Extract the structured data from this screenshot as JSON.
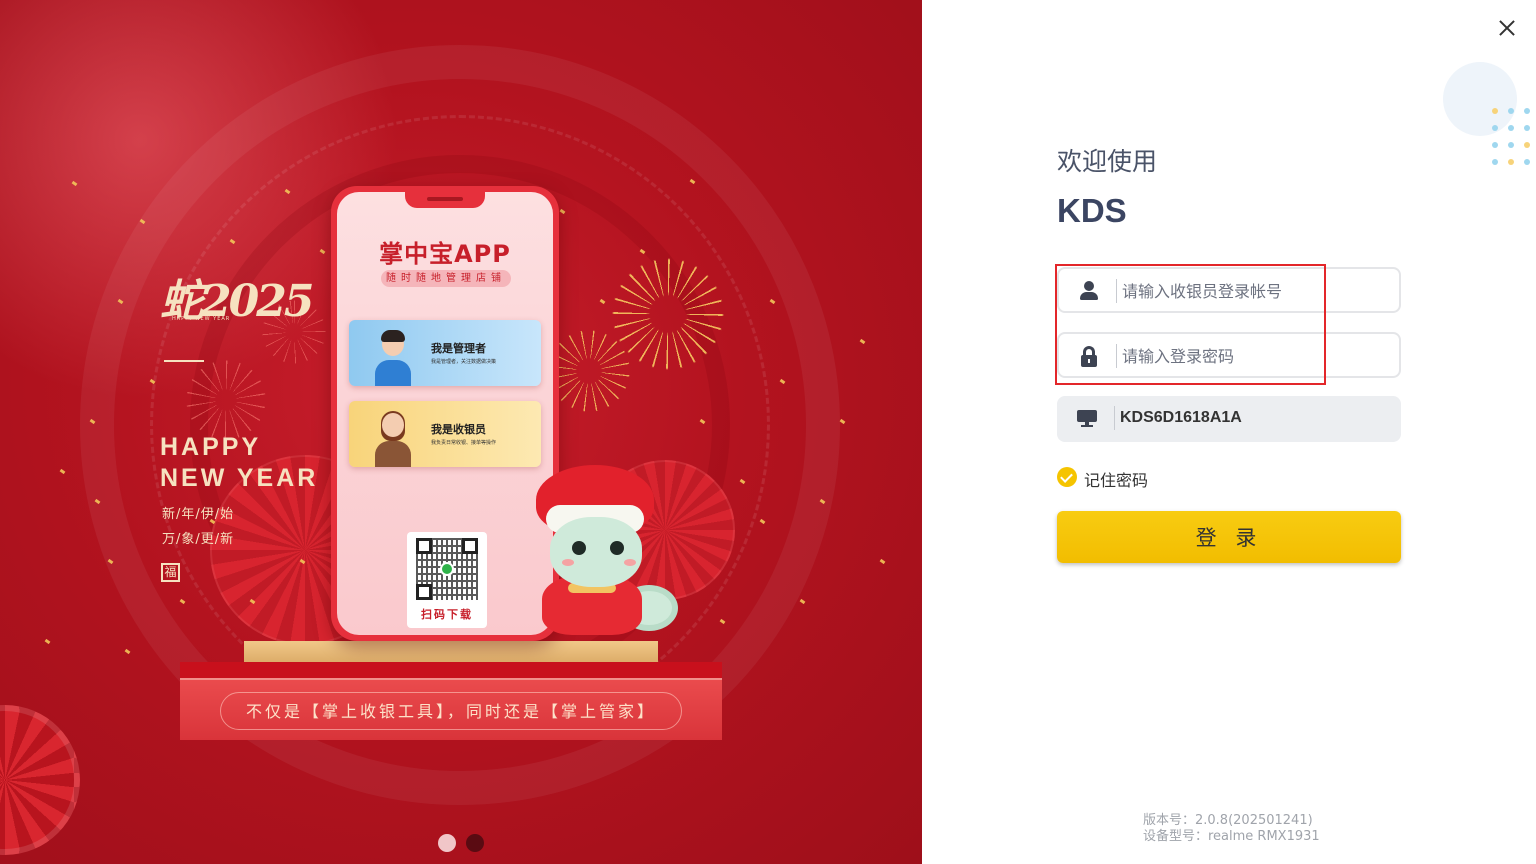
{
  "banner": {
    "calligraphy": "蛇2025",
    "calligraphy_small": "HAPPY NEW YEAR",
    "happy_line1": "HAPPY",
    "happy_line2": "NEW YEAR",
    "blessing_line1": "新/年/伊/始",
    "blessing_line2": "万/象/更/新",
    "seal": "福",
    "phone": {
      "app_title": "掌中宝APP",
      "app_subtitle": "随时随地管理店铺",
      "manager_title": "我是管理者",
      "manager_desc": "我是管理者，关注数据做决策",
      "cashier_title": "我是收银员",
      "cashier_desc": "我负责日常收银、接单等操作",
      "qr_label": "扫码下载"
    },
    "plaque_text": "不仅是【掌上收银工具】，同时还是【掌上管家】",
    "carousel": {
      "total": 2,
      "active": 2
    }
  },
  "login": {
    "welcome": "欢迎使用",
    "app_name": "KDS",
    "account_placeholder": "请输入收银员登录帐号",
    "account_value": "",
    "password_placeholder": "请输入登录密码",
    "password_value": "",
    "device_id": "KDS6D1618A1A",
    "remember_label": "记住密码",
    "remember_checked": true,
    "login_button": "登 录"
  },
  "footer": {
    "version": "版本号：2.0.8(202501241)",
    "device_model": "设备型号：realme RMX1931"
  },
  "icons": {
    "account": "user-icon",
    "password": "lock-icon",
    "device": "monitor-icon",
    "close": "close-icon",
    "remember": "check-circle-icon"
  },
  "colors": {
    "banner_red": "#b3131f",
    "accent_yellow": "#f5c400",
    "highlight_red": "#e3262a",
    "title_navy": "#3b4562"
  }
}
